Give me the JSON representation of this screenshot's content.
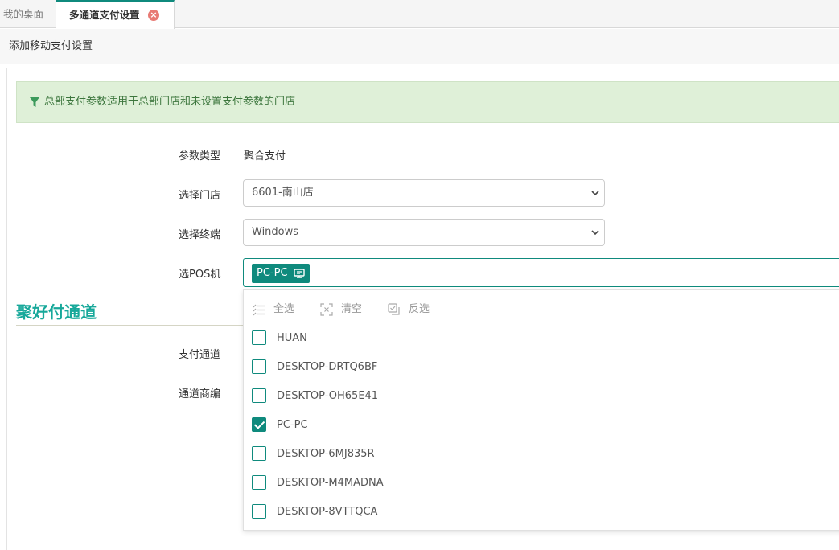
{
  "tabs": {
    "home_label": "我的桌面",
    "active_label": "多通道支付设置",
    "close_glyph": "×"
  },
  "subheader": {
    "title": "添加移动支付设置"
  },
  "alert": {
    "text": "总部支付参数适用于总部门店和未设置支付参数的门店",
    "icon": "funnel-icon"
  },
  "form": {
    "param_type_label": "参数类型",
    "param_type_value": "聚合支付",
    "store_label": "选择门店",
    "store_value": "6601-南山店",
    "terminal_label": "选择终端",
    "terminal_value": "Windows",
    "pos_label": "选POS机",
    "pos_selected_chip": "PC-PC"
  },
  "section": {
    "title": "聚好付通道",
    "channel_label": "支付通道",
    "merchant_label": "通道商编"
  },
  "dropdown": {
    "select_all": "全选",
    "clear": "清空",
    "invert": "反选",
    "items": [
      {
        "label": "HUAN",
        "checked": false
      },
      {
        "label": "DESKTOP-DRTQ6BF",
        "checked": false
      },
      {
        "label": "DESKTOP-OH65E41",
        "checked": false
      },
      {
        "label": "PC-PC",
        "checked": true
      },
      {
        "label": "DESKTOP-6MJ835R",
        "checked": false
      },
      {
        "label": "DESKTOP-M4MADNA",
        "checked": false
      },
      {
        "label": "DESKTOP-8VTTQCA",
        "checked": false
      }
    ]
  },
  "colors": {
    "accent": "#0f8a7d",
    "section_title": "#17a89a",
    "alert_bg": "#dff0d8",
    "alert_text": "#3c763d"
  }
}
